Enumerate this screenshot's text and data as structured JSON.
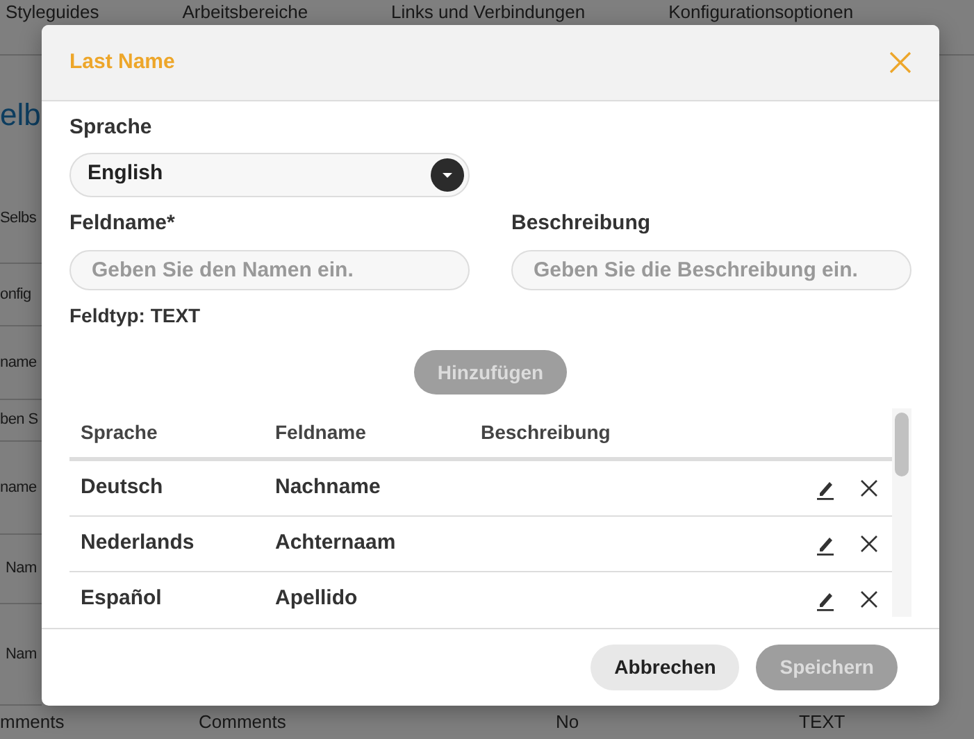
{
  "background": {
    "tabs": [
      "Styleguides",
      "Arbeitsbereiche",
      "Links und Verbindungen",
      "Konfigurationsoptionen"
    ],
    "heading": "elb",
    "rows": [
      "Selbs",
      "onfig",
      "name",
      "ben S",
      "name",
      "Nam",
      "Nam"
    ],
    "bottom_row": [
      "mments",
      "Comments",
      "No",
      "TEXT"
    ]
  },
  "dialog": {
    "title": "Last Name",
    "language": {
      "label": "Sprache",
      "value": "English"
    },
    "field_name": {
      "label": "Feldname*",
      "placeholder": "Geben Sie den Namen ein."
    },
    "description": {
      "label": "Beschreibung",
      "placeholder": "Geben Sie die Beschreibung ein."
    },
    "field_type": "Feldtyp: TEXT",
    "add_button": {
      "label": "Hinzufügen",
      "disabled": true
    },
    "table": {
      "columns": [
        "Sprache",
        "Feldname",
        "Beschreibung"
      ],
      "rows": [
        {
          "language": "Deutsch",
          "field_name": "Nachname"
        },
        {
          "language": "Nederlands",
          "field_name": "Achternaam"
        },
        {
          "language": "Español",
          "field_name": "Apellido"
        }
      ]
    },
    "buttons": [
      {
        "label": "Abbrechen",
        "kind": "cancel",
        "disabled": false
      },
      {
        "label": "Speichern",
        "kind": "save",
        "disabled": true
      }
    ]
  }
}
